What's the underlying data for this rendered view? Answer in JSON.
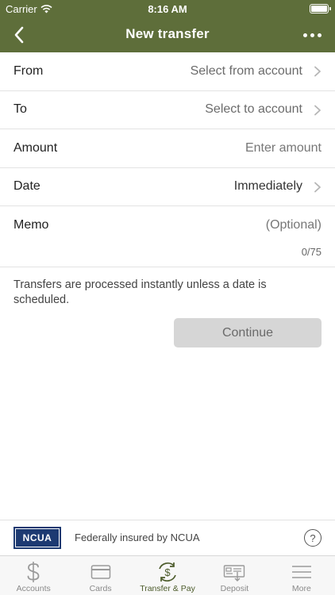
{
  "status_bar": {
    "carrier": "Carrier",
    "time": "8:16 AM"
  },
  "nav": {
    "title": "New transfer"
  },
  "form": {
    "from": {
      "label": "From",
      "value": "Select from account"
    },
    "to": {
      "label": "To",
      "value": "Select to account"
    },
    "amount": {
      "label": "Amount",
      "placeholder": "Enter amount"
    },
    "date": {
      "label": "Date",
      "value": "Immediately"
    },
    "memo": {
      "label": "Memo",
      "placeholder": "(Optional)",
      "counter": "0/75"
    }
  },
  "info_text": "Transfers are processed instantly unless a date is scheduled.",
  "continue_label": "Continue",
  "footer": {
    "logo_text": "NCUA",
    "insured_text": "Federally insured by NCUA",
    "help_glyph": "?"
  },
  "tabs": [
    {
      "label": "Accounts",
      "icon": "dollar-icon"
    },
    {
      "label": "Cards",
      "icon": "card-icon"
    },
    {
      "label": "Transfer & Pay",
      "icon": "transfer-pay-icon",
      "active": true
    },
    {
      "label": "Deposit",
      "icon": "deposit-check-icon"
    },
    {
      "label": "More",
      "icon": "menu-icon"
    }
  ],
  "colors": {
    "header": "#5e6e3a",
    "active_tab": "#4d5c2c",
    "button_disabled": "#d6d6d6"
  }
}
